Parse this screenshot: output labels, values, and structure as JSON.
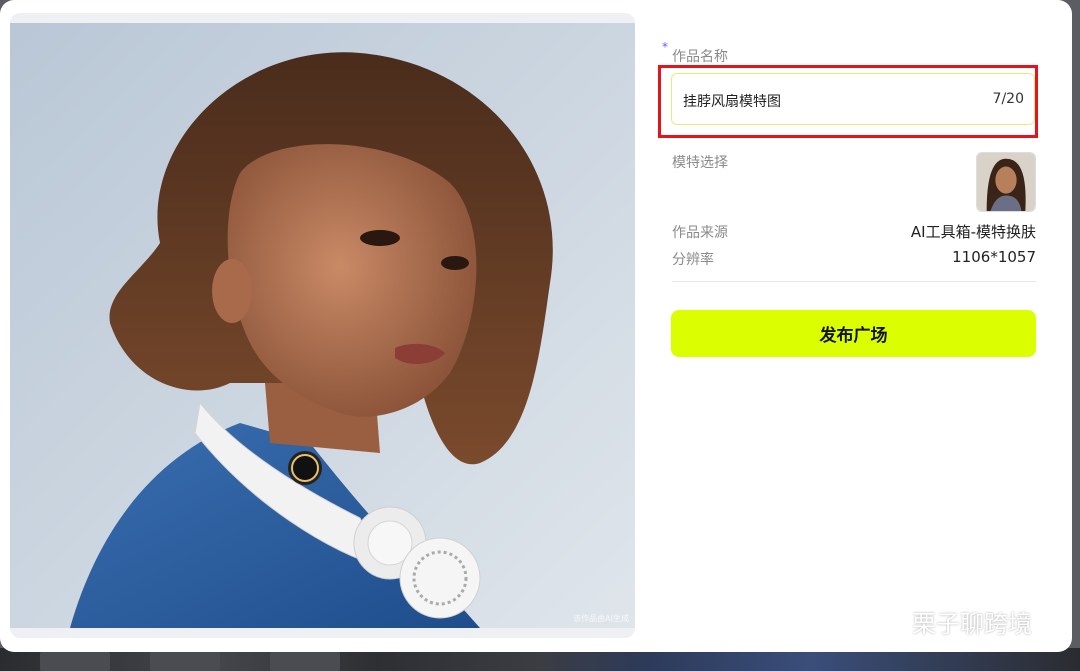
{
  "form": {
    "required_mark": "*",
    "title_label": "作品名称",
    "title_value": "挂脖风扇模特图",
    "title_count": "7/20",
    "model_label": "模特选择",
    "source_label": "作品来源",
    "source_value": "AI工具箱-模特换肤",
    "resolution_label": "分辨率",
    "resolution_value": "1106*1057",
    "publish_label": "发布广场"
  },
  "image": {
    "watermark": "该作品由AI生成"
  },
  "brand": {
    "name": "栗子聊跨境",
    "icon": "wechat-icon"
  },
  "colors": {
    "accent": "#dcff00",
    "highlight": "#e3141c",
    "required": "#6b5cff"
  }
}
